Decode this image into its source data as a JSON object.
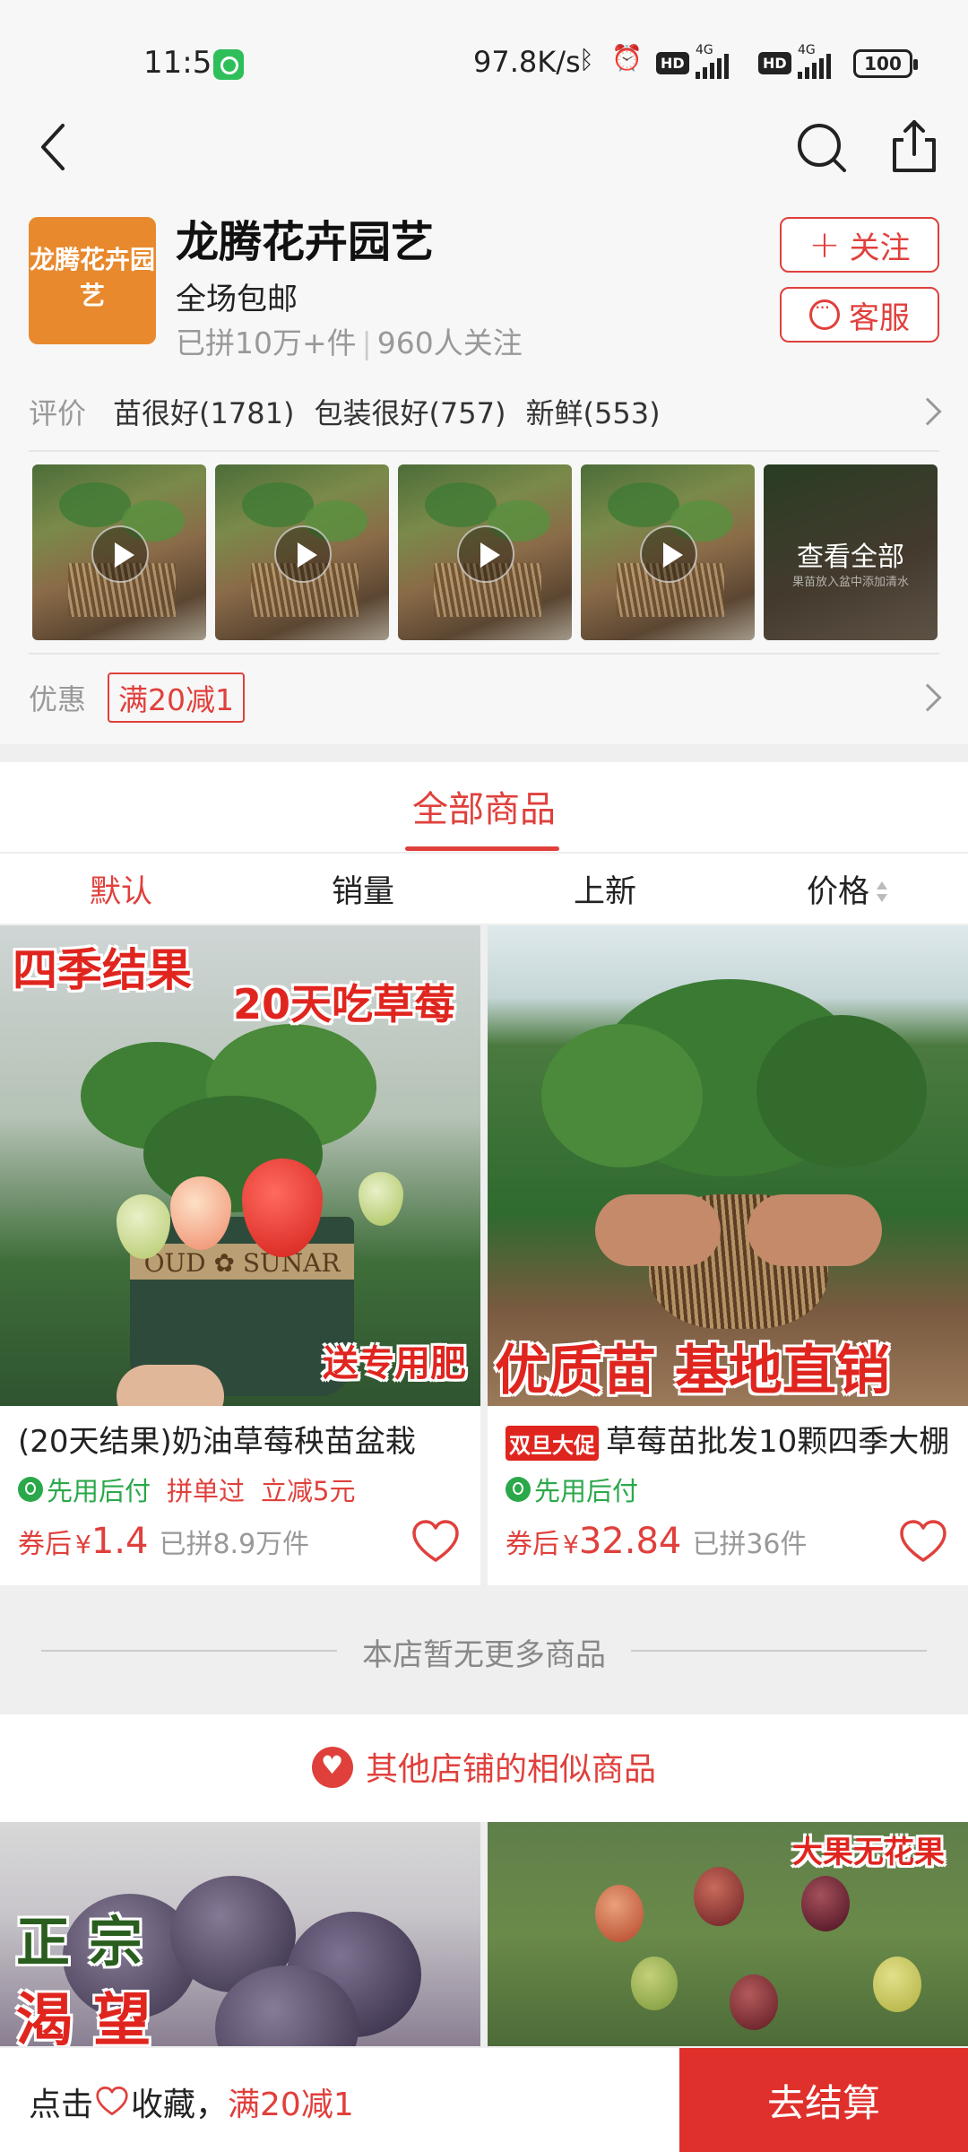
{
  "status_bar": {
    "time": "11:51",
    "net_speed": "97.8K/s",
    "network_type": "4G",
    "battery": "100",
    "icons": [
      "bluetooth-icon",
      "alarm-icon",
      "hd-icon",
      "signal-icon",
      "hd-icon",
      "signal-icon"
    ]
  },
  "nav": {
    "icons": [
      "back-icon",
      "search-icon",
      "share-icon"
    ]
  },
  "shop": {
    "logo_text": "龙腾花卉园艺",
    "name": "龙腾花卉园艺",
    "subtitle": "全场包邮",
    "sold": "已拼10万+件",
    "followers": "960人关注",
    "follow_label": "关注",
    "service_label": "客服"
  },
  "reviews": {
    "label": "评价",
    "tags": [
      "苗很好(1781)",
      "包装很好(757)",
      "新鲜(553)"
    ]
  },
  "media": {
    "view_all": "查看全部",
    "view_all_sub": "果苗放入盆中添加清水"
  },
  "promo": {
    "label": "优惠",
    "coupon": "满20减1"
  },
  "tabs": {
    "all_products": "全部商品",
    "sort": [
      "默认",
      "销量",
      "上新",
      "价格"
    ],
    "active_sort": "默认"
  },
  "products": [
    {
      "image_overlays": [
        "四季结果",
        "20天吃草莓",
        "送专用肥"
      ],
      "pot_text": "OUD ✿ SUNAR",
      "title": "(20天结果)奶油草莓秧苗盆栽",
      "badge": "",
      "tags": [
        "先用后付",
        "拼单过",
        "立减5元"
      ],
      "price_prefix": "券后",
      "currency": "¥",
      "price": "1.4",
      "sold": "已拼8.9万件"
    },
    {
      "image_overlays": [
        "优质苗 基地直销"
      ],
      "title": "草莓苗批发10颗四季大棚",
      "badge": "双旦大促",
      "tags": [
        "先用后付"
      ],
      "price_prefix": "券后",
      "currency": "¥",
      "price": "32.84",
      "sold": "已拼36件"
    }
  ],
  "end_notice": "本店暂无更多商品",
  "similar": {
    "title": "其他店铺的相似商品",
    "items": [
      {
        "overlays": [
          "正 宗",
          "渴 望"
        ]
      },
      {
        "overlays": [
          "大果无花果"
        ]
      }
    ]
  },
  "bottom_bar": {
    "collect_prefix": "点击",
    "collect_suffix": "收藏，",
    "collect_promo": "满20减1",
    "checkout": "去结算"
  },
  "colors": {
    "accent": "#e0403c",
    "green_pay": "#2aa84a",
    "logo_bg": "#e8892e"
  }
}
